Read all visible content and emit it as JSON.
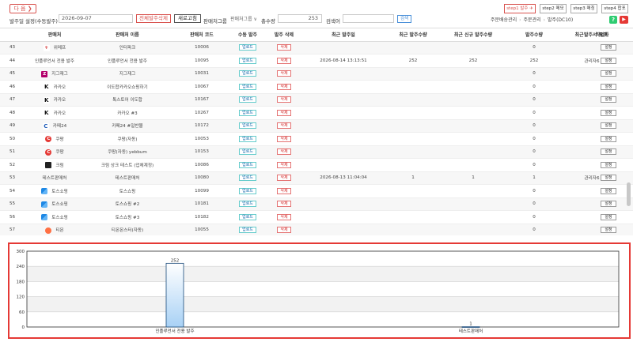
{
  "toolbar": {
    "next_label": "다 음 ❯",
    "date_label": "발주일 설정(수동발주)",
    "date_value": "2026-09-07",
    "delete_all_label": "전체발주삭제",
    "refresh_label": "새로고침",
    "group_label": "판매처그룹",
    "group_select": "판매처그룹 ∨",
    "total_label": "총수량",
    "total_value": "253",
    "search_label": "검색어",
    "search_button": "검색"
  },
  "steps": [
    "step1 발주 ✈",
    "step2 메모",
    "step3 매칭",
    "step4 합포"
  ],
  "breadcrumb": [
    "주문배송관리",
    "주문관리",
    "발주(DC10)"
  ],
  "icons": {
    "help": "?",
    "youtube": "▶"
  },
  "table": {
    "headers": [
      "",
      "판매처",
      "판매처 이름",
      "판매처 코드",
      "수동 발주",
      "발주 삭제",
      "최근 발주일",
      "최근 발주수량",
      "최근 신규 발주수량",
      "발주수량",
      "최근 발주 작업자",
      "발주서 포맷"
    ],
    "buttons": {
      "upload": "업로드",
      "delete": "삭제",
      "setting": "설정"
    },
    "rows": [
      {
        "idx": "43",
        "shop": "위메프",
        "icon": "w",
        "name": "인터파크",
        "code": "10006",
        "date": "",
        "recent": "",
        "new": "",
        "qty": "0",
        "worker": ""
      },
      {
        "idx": "44",
        "shop": "인플루언서 전용 발주",
        "icon": "none",
        "name": "인플루언서 전용 발주",
        "code": "10095",
        "date": "2026-08-14 13:13:51",
        "recent": "252",
        "new": "252",
        "qty": "252",
        "worker": "관리자6"
      },
      {
        "idx": "45",
        "shop": "지그재그",
        "icon": "z",
        "name": "지그재그",
        "code": "10031",
        "date": "",
        "recent": "",
        "new": "",
        "qty": "0",
        "worker": ""
      },
      {
        "idx": "46",
        "shop": "카카오",
        "icon": "k",
        "name": "이도합카카오쇼핑하기",
        "code": "10067",
        "date": "",
        "recent": "",
        "new": "",
        "qty": "0",
        "worker": ""
      },
      {
        "idx": "47",
        "shop": "카카오",
        "icon": "k",
        "name": "톡스토어 이도합",
        "code": "10167",
        "date": "",
        "recent": "",
        "new": "",
        "qty": "0",
        "worker": ""
      },
      {
        "idx": "48",
        "shop": "카카오",
        "icon": "k",
        "name": "카카오 #3",
        "code": "10267",
        "date": "",
        "recent": "",
        "new": "",
        "qty": "0",
        "worker": ""
      },
      {
        "idx": "49",
        "shop": "카페24",
        "icon": "c",
        "name": "카페24 #일반몰",
        "code": "10172",
        "date": "",
        "recent": "",
        "new": "",
        "qty": "0",
        "worker": ""
      },
      {
        "idx": "50",
        "shop": "쿠팡",
        "icon": "cp",
        "name": "쿠팡(자동)",
        "code": "10053",
        "date": "",
        "recent": "",
        "new": "",
        "qty": "0",
        "worker": ""
      },
      {
        "idx": "51",
        "shop": "쿠팡",
        "icon": "cp",
        "name": "쿠팡(자동) yebbum",
        "code": "10153",
        "date": "",
        "recent": "",
        "new": "",
        "qty": "0",
        "worker": ""
      },
      {
        "idx": "52",
        "shop": "크림",
        "icon": "bl",
        "name": "크림 상크 테스트 (업체계정)",
        "code": "10086",
        "date": "",
        "recent": "",
        "new": "",
        "qty": "0",
        "worker": ""
      },
      {
        "idx": "53",
        "shop": "테스트판매처",
        "icon": "none",
        "name": "테스트판매처",
        "code": "10080",
        "date": "2026-08-13 11:04:04",
        "recent": "1",
        "new": "1",
        "qty": "1",
        "worker": "관리자6"
      },
      {
        "idx": "54",
        "shop": "토스쇼핑",
        "icon": "ts",
        "name": "토스쇼핑",
        "code": "10099",
        "date": "",
        "recent": "",
        "new": "",
        "qty": "0",
        "worker": ""
      },
      {
        "idx": "55",
        "shop": "토스쇼핑",
        "icon": "ts",
        "name": "토스쇼핑 #2",
        "code": "10181",
        "date": "",
        "recent": "",
        "new": "",
        "qty": "0",
        "worker": ""
      },
      {
        "idx": "56",
        "shop": "토스쇼핑",
        "icon": "ts",
        "name": "토스쇼핑 #3",
        "code": "10182",
        "date": "",
        "recent": "",
        "new": "",
        "qty": "0",
        "worker": ""
      },
      {
        "idx": "57",
        "shop": "티몬",
        "icon": "tb",
        "name": "티몬몬스터(자동)",
        "code": "10055",
        "date": "",
        "recent": "",
        "new": "",
        "qty": "0",
        "worker": ""
      },
      {
        "idx": "58",
        "shop": "한섬eql",
        "icon": "bl2",
        "name": "한섬EQL carriere2025",
        "code": "10090",
        "date": "",
        "recent": "",
        "new": "",
        "qty": "0",
        "worker": ""
      }
    ]
  },
  "chart_data": {
    "type": "bar",
    "categories": [
      "인플루언서 전용 발주",
      "테스트판매처"
    ],
    "values": [
      252,
      1
    ],
    "ylim": [
      0,
      300
    ],
    "yticks": [
      0,
      60,
      120,
      180,
      240,
      300
    ],
    "grid": true,
    "colors": {
      "bar_top": "#ffffff",
      "bar_bottom": "#a8d1f5",
      "bar_stroke": "#1a4a7a",
      "frame": "#e53935"
    }
  }
}
